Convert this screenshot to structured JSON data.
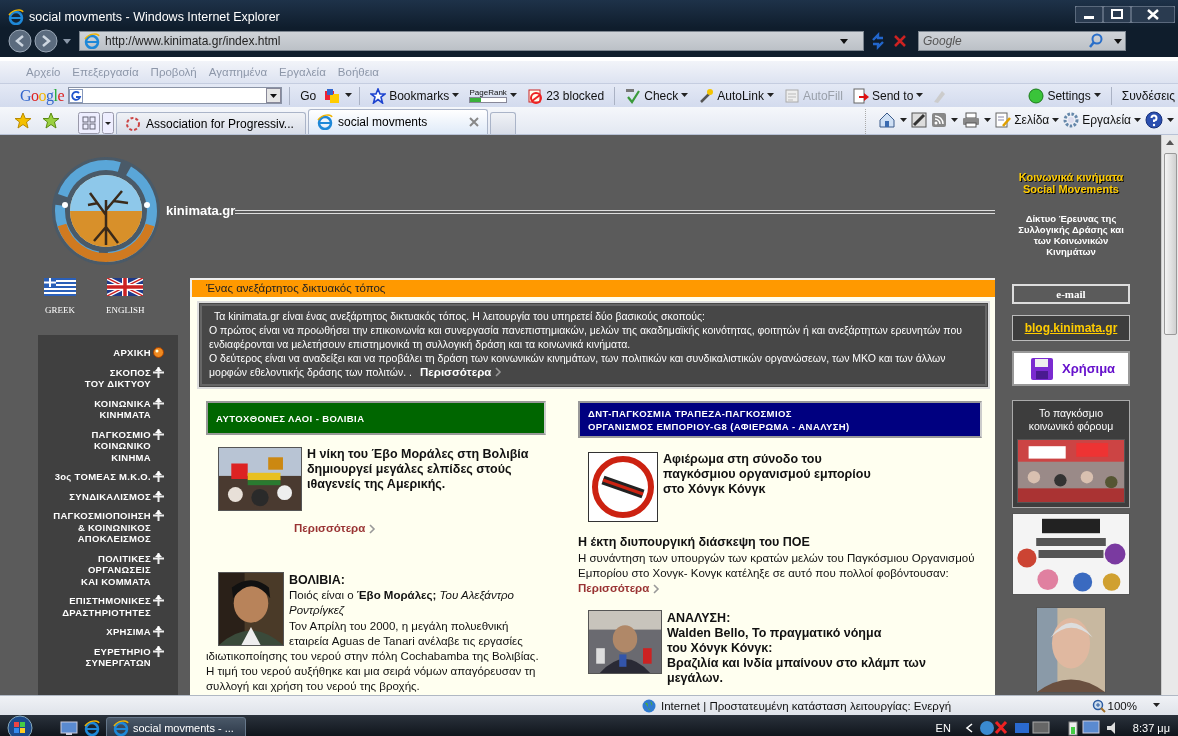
{
  "browser": {
    "title": "social movments - Windows Internet Explorer",
    "url": "http://www.kinimata.gr/index.html",
    "search_placeholder": "Google",
    "menu": [
      "Αρχείο",
      "Επεξεργασία",
      "Προβολή",
      "Αγαπημένα",
      "Εργαλεία",
      "Βοήθεια"
    ],
    "brand": "Google",
    "toolbar": [
      {
        "label": "Go",
        "kind": "plain",
        "disabled": false
      },
      {
        "label": "Bookmarks",
        "kind": "menu",
        "disabled": false
      },
      {
        "label": "PageRank",
        "kind": "meter",
        "level": 0.3,
        "disabled": false
      },
      {
        "label": "23 blocked",
        "kind": "plain",
        "disabled": false
      },
      {
        "label": "Check",
        "kind": "menu",
        "disabled": false
      },
      {
        "label": "AutoLink",
        "kind": "menu",
        "disabled": false
      },
      {
        "label": "AutoFill",
        "kind": "plain",
        "disabled": true
      },
      {
        "label": "Send to",
        "kind": "menu",
        "disabled": false
      }
    ],
    "toolbar_end": [
      {
        "label": "Settings",
        "kind": "menu",
        "disabled": false
      },
      {
        "label": "Συνδέσεις",
        "kind": "plain",
        "disabled": false
      }
    ],
    "tabs": [
      {
        "label": "Association for Progressiv...",
        "selected": false
      },
      {
        "label": "social movments",
        "selected": true
      }
    ],
    "commands": [
      "Σελίδα",
      "Εργαλεία"
    ]
  },
  "page": {
    "site_name": "kinimata.gr",
    "tagline": [
      "Κοινωνικά κινήματα",
      "Social Movements"
    ],
    "network_title": "Δίκτυο Έρευνας της Συλλογικής Δράσης και των Κοινωνικών Κινημάτων",
    "languages": [
      {
        "label": "GREEK"
      },
      {
        "label": "ENGLISH"
      }
    ],
    "nav": [
      {
        "label": "ΑΡΧΙΚΗ",
        "kind": "home"
      },
      {
        "label": "ΣΚΟΠΟΣ\nΤΟΥ ΔΙΚΤΥΟΥ",
        "kind": "section"
      },
      {
        "label": "ΚΟΙΝΩΝΙΚΑ\nΚΙΝΗΜΑΤΑ",
        "kind": "section"
      },
      {
        "label": "ΠΑΓΚΟΣΜΙΟ\nΚΟΙΝΩΝΙΚΟ\nΚΙΝΗΜΑ",
        "kind": "section"
      },
      {
        "label": "3ος ΤΟΜΕΑΣ Μ.Κ.Ο.",
        "kind": "section"
      },
      {
        "label": "ΣΥΝΔΙΚΑΛΙΣΜΟΣ",
        "kind": "section"
      },
      {
        "label": "ΠΑΓΚΟΣΜΙΟΠΟΙΗΣΗ\n& ΚΟΙΝΩΝΙΚΟΣ\nΑΠΟΚΛΕΙΣΜΟΣ",
        "kind": "section"
      },
      {
        "label": "ΠΟΛΙΤΙΚΕΣ\nΟΡΓΑΝΩΣΕΙΣ\nΚΑΙ ΚΟΜΜΑΤΑ",
        "kind": "section"
      },
      {
        "label": "ΕΠΙΣΤΗΜΟΝΙΚΕΣ\nΔΡΑΣΤΗΡΙΟΤΗΤΕΣ",
        "kind": "section"
      },
      {
        "label": "ΧΡΗΣΙΜΑ",
        "kind": "section"
      },
      {
        "label": "ΕΥΡΕΤΗΡΙΟ\nΣΥΝΕΡΓΑΤΩΝ",
        "kind": "section"
      }
    ],
    "banner": "Ένας ανεξάρτητος δικτυακός τόπος",
    "intro": {
      "paragraphs": [
        "Τα kinimata.gr είναι ένας ανεξάρτητος δικτυακός τόπος. Η λειτουργία του υπηρετεί δύο βασικούς σκοπούς:",
        "Ο πρώτος είναι να προωθήσει την επικοινωνία και συνεργασία πανεπιστημιακών, μελών της ακαδημαϊκής κοινότητας, φοιτητών ή και ανεξάρτητων ερευνητών που ενδιαφέρονται να μελετήσουν επιστημονικά τη συλλογική δράση και τα κοινωνικά κινήματα.",
        "Ο δεύτερος είναι να αναδείξει και να προβάλει τη δράση των κοινωνικών κινημάτων, των πολιτικών και συνδικαλιστικών οργανώσεων, των ΜΚΟ και των άλλων μορφών εθελοντικής δράσης των πολιτών. ."
      ],
      "more": "Περισσότερα"
    },
    "sections": [
      {
        "title": "ΑΥΤΟΧΘΟΝΕΣ ΛΑΟΙ - ΒΟΛΙΒΙΑ",
        "color": "#006600",
        "articles": [
          {
            "title": "Η νίκη του Έβο Μοράλες στη Βολιβία δημιουργεί μεγάλες ελπίδες στούς ιθαγενείς της Αμερικής.",
            "more": "Περισσότερα"
          },
          {
            "kind": "portrait",
            "heading": "ΒΟΛΙΒΙΑ:",
            "lead": "Ποιός είναι ο **Έβο Μοράλες;**  *Του Αλεξάντρο Ροντρίγκεζ*",
            "body": "Τον Απρίλη του 2000, η μεγάλη πολυεθνική εταιρεία Aguas de Tanari ανέλαβε τις εργασίες ιδιωτικοποίησης του νερού στην πόλη Cochabamba της Βολιβίας. Η τιμή του νερού αυξήθηκε και μια σειρά νόμων απαγόρευσαν τη συλλογή και χρήση του νερού της βροχής."
          }
        ]
      },
      {
        "title": "ΔΝΤ-ΠΑΓΚΟΣΜΙΑ ΤΡΑΠΕΖΑ-ΠΑΓΚΟΣΜΙΟΣ\nΟΡΓΑΝΙΣΜΟΣ ΕΜΠΟΡΙΟΥ-G8  (ΑΦΙΕΡΩΜΑ - ΑΝΑΛΥΣΗ)",
        "color": "#000080",
        "articles": [
          {
            "kind": "sign",
            "title": "Αφιέρωμα στη σύνοδο του\nπαγκόσμιου οργανισμού εμπορίου\nστο Χόνγκ Κόνγκ"
          },
          {
            "kind": "text",
            "heading": "Η έκτη διυπουργική διάσκεψη του ΠΟΕ",
            "body": "Η συνάντηση των υπουργών των κρατών μελών του Παγκόσμιου Οργανισμού Εμπορίου στο Χονγκ- Κονγκ κατέληξε σε αυτό που πολλοί φοβόντουσαν:",
            "more": "Περισσότερα"
          },
          {
            "heading": "ΑΝΑΛΥΣΗ:",
            "title": "Walden Bello, Το πραγματικό νόημα\nτου Χόνγκ Κόνγκ:\nΒραζιλία και Ινδία μπαίνουν στο κλάμπ των μεγάλων."
          }
        ]
      }
    ],
    "email": "e-mail",
    "blog": "blog.kinimata.gr",
    "useful": "Χρήσιμα",
    "forum": "Το παγκόσμιο κοινωνικό φόρουμ"
  },
  "status": {
    "text": "Internet | Προστατευμένη κατάσταση λειτουργίας: Ενεργή",
    "zoom": "100%"
  },
  "taskbar": {
    "task": "social movments - ...",
    "language": "EN",
    "time": "8:37 μμ"
  }
}
